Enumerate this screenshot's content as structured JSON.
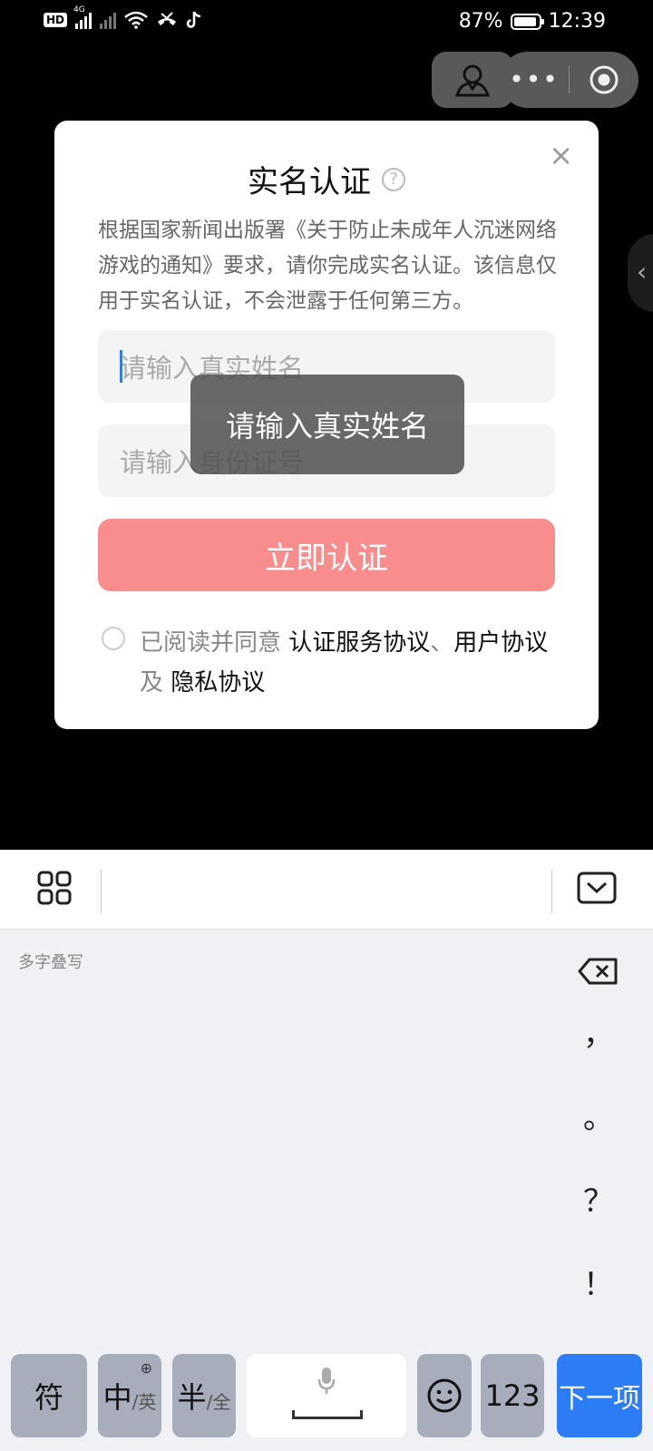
{
  "status_bar": {
    "hd": "HD",
    "network": "4G",
    "battery": "87%",
    "time": "12:39"
  },
  "dialog": {
    "title": "实名认证",
    "help": "?",
    "close": "×",
    "description": "根据国家新闻出版署《关于防止未成年人沉迷网络游戏的通知》要求，请你完成实名认证。该信息仅用于实名认证，不会泄露于任何第三方。",
    "name_placeholder": "请输入真实姓名",
    "id_placeholder": "请输入身份证号",
    "submit_label": "立即认证",
    "agree_prefix": "已阅读并同意 ",
    "link_service": "认证服务协议",
    "sep": "、",
    "link_user": "用户协议",
    "and": " 及 ",
    "link_privacy": "隐私协议"
  },
  "toast": {
    "text": "请输入真实姓名"
  },
  "keyboard": {
    "hint": "多字叠写",
    "punct": [
      "，",
      "。",
      "？",
      "！"
    ],
    "symbols_key": "符",
    "zh_key": "中",
    "zh_sub": "/英",
    "half_key": "半",
    "half_sub": "/全",
    "num_key": "123",
    "enter_key": "下一项"
  }
}
